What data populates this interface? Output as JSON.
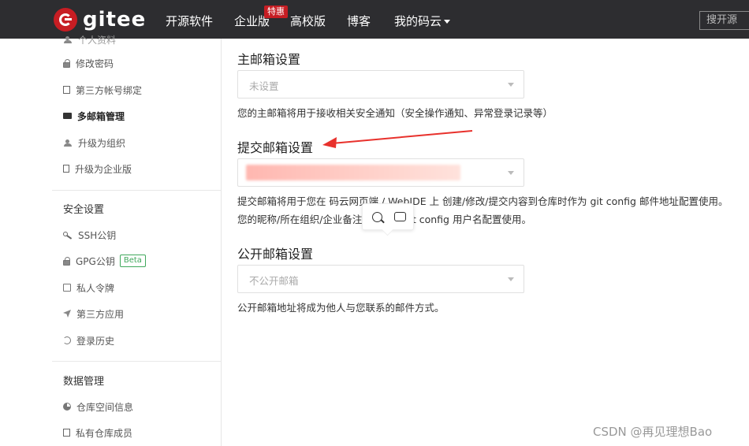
{
  "nav": {
    "logo_text": "gitee",
    "items": [
      "开源软件",
      "企业版",
      "高校版",
      "博客",
      "我的码云"
    ],
    "hot_badge": "特惠",
    "search_placeholder": "搜开源"
  },
  "sidebar": {
    "top_partial": "个人资料",
    "items": [
      {
        "label": "修改密码",
        "icon": "lock-icon"
      },
      {
        "label": "第三方帐号绑定",
        "icon": "square-icon"
      },
      {
        "label": "多邮箱管理",
        "icon": "mail-icon",
        "active": true
      },
      {
        "label": "升级为组织",
        "icon": "users-icon"
      },
      {
        "label": "升级为企业版",
        "icon": "book-icon"
      }
    ],
    "security_title": "安全设置",
    "security_items": [
      {
        "label": "SSH公钥",
        "icon": "key-icon"
      },
      {
        "label": "GPG公钥",
        "icon": "lock-icon",
        "badge": "Beta"
      },
      {
        "label": "私人令牌",
        "icon": "token-icon"
      },
      {
        "label": "第三方应用",
        "icon": "rocket-icon"
      },
      {
        "label": "登录历史",
        "icon": "history-icon"
      }
    ],
    "data_title": "数据管理",
    "data_items": [
      {
        "label": "仓库空间信息",
        "icon": "pie-icon"
      },
      {
        "label": "私有仓库成员",
        "icon": "square-icon"
      }
    ]
  },
  "main": {
    "primary": {
      "title": "主邮箱设置",
      "value": "未设置",
      "hint": "您的主邮箱将用于接收相关安全通知（安全操作通知、异常登录记录等）"
    },
    "commit": {
      "title": "提交邮箱设置",
      "hint1": "提交邮箱将用于您在 码云网页端 / WebIDE 上 创建/修改/提交内容到仓库时作为 git config 邮件地址配置使用。",
      "hint2_pre": "您的昵称/所在组织/企业备注",
      "hint2_post": "git config 用户名配置使用。"
    },
    "public": {
      "title": "公开邮箱设置",
      "value": "不公开邮箱",
      "hint": "公开邮箱地址将成为他人与您联系的邮件方式。"
    }
  },
  "colors": {
    "nav_bg": "#2d2d30",
    "brand_red": "#c71d23",
    "beta_green": "#40a85c",
    "arrow_red": "#e8312c"
  },
  "watermark": "CSDN @再见理想Bao"
}
